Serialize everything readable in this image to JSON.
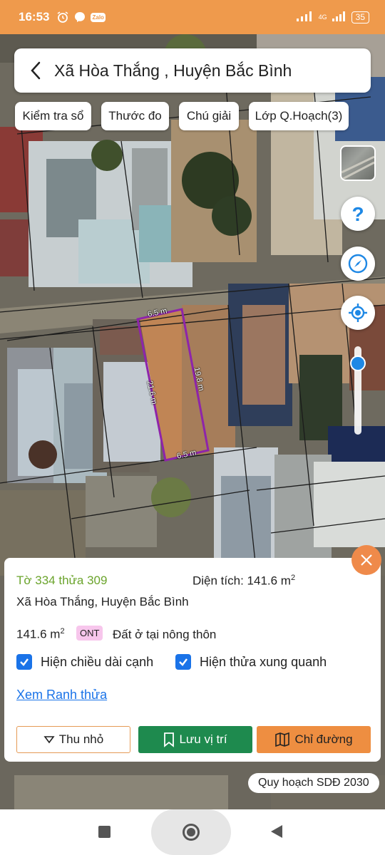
{
  "status_bar": {
    "time": "16:53",
    "network": "4G",
    "battery": "35",
    "icons": [
      "alarm-icon",
      "messenger-icon",
      "zalo-icon",
      "signal-icon",
      "battery-icon"
    ]
  },
  "header": {
    "title": "Xã Hòa Thắng , Huyện Bắc Bình"
  },
  "toolbar": {
    "chips": [
      "Kiểm tra sổ",
      "Thước đo",
      "Chú giải",
      "Lớp Q.Hoạch(3)"
    ]
  },
  "map": {
    "side_buttons": [
      "layer-thumbnail",
      "help-icon",
      "compass-icon",
      "locate-icon"
    ],
    "zoom_level": 0.93,
    "dimensions": {
      "top": "6.5 m",
      "bottom": "6.5 m",
      "left": "21.6 m",
      "right": "19.8 m"
    },
    "parcel_outline_color": "#8e24aa"
  },
  "info": {
    "parcel_id": "Tờ 334 thửa 309",
    "area_label": "Diện tích: 141.6 m",
    "area_sup": "2",
    "address": "Xã Hòa Thắng, Huyện Bắc Bình",
    "area_value": "141.6 m",
    "area_value_sup": "2",
    "land_code": "ONT",
    "land_type": "Đất ở tại nông thôn",
    "checkbox_edges": "Hiện chiều dài cạnh",
    "checkbox_neighbors": "Hiện thửa xung quanh",
    "view_boundary": "Xem Ranh thửa",
    "btn_collapse": "Thu nhỏ",
    "btn_save": "Lưu vị trí",
    "btn_route": "Chỉ đường"
  },
  "plan_label": "Quy hoạch SDĐ 2030",
  "colors": {
    "accent": "#ef9a4c",
    "green": "#1e8a4e",
    "link": "#1a73e8",
    "parcel_id": "#6ba42c"
  }
}
